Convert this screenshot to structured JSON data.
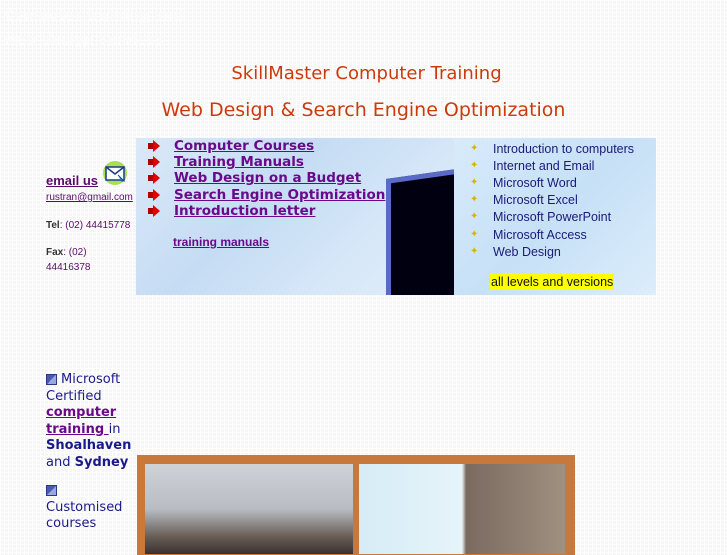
{
  "header": {
    "faint_line_1": "Computer training and",
    "faint_line_2": "web design services",
    "title": "SkillMaster Computer Training",
    "subtitle": "Web Design & Search Engine Optimization"
  },
  "contact": {
    "email_label": "email us",
    "email_address": "rustran@gmail.com",
    "tel_label": "Tel",
    "tel_value": ": (02) 44415778",
    "fax_label": "Fax",
    "fax_value": ": (02) 44416378",
    "mail_icon": "envelope-icon"
  },
  "nav": {
    "items": [
      {
        "label": "Computer Courses",
        "icon": "red-arrow-icon"
      },
      {
        "label": "Training Manuals",
        "icon": "red-arrow-icon"
      },
      {
        "label": "Web Design on a Budget",
        "icon": "red-arrow-icon"
      },
      {
        "label": "Search Engine Optimization",
        "icon": "red-arrow-icon"
      },
      {
        "label": "Introduction letter",
        "icon": "red-arrow-icon"
      }
    ],
    "extra_link": "training manuals"
  },
  "courses": {
    "items": [
      "Introduction to computers",
      "Internet and Email",
      "Microsoft Word",
      "Microsoft Excel",
      "Microsoft PowerPoint",
      "Microsoft Access",
      "Web Design"
    ],
    "note": "all levels and versions",
    "bullet_icon": "star-icon"
  },
  "features": {
    "f1_pre": "Microsoft Certified",
    "f1_link": "computer training ",
    "f1_in": "in",
    "f1_place1": "Shoalhaven",
    "f1_and": "and",
    "f1_place2": "Sydney",
    "f2_text": "Customised courses"
  },
  "colors": {
    "title": "#cc3a0c",
    "link": "#6a0a8a",
    "course_text": "#1a1a7a",
    "highlight": "#ffff00",
    "photo_frame": "#c8783a"
  }
}
